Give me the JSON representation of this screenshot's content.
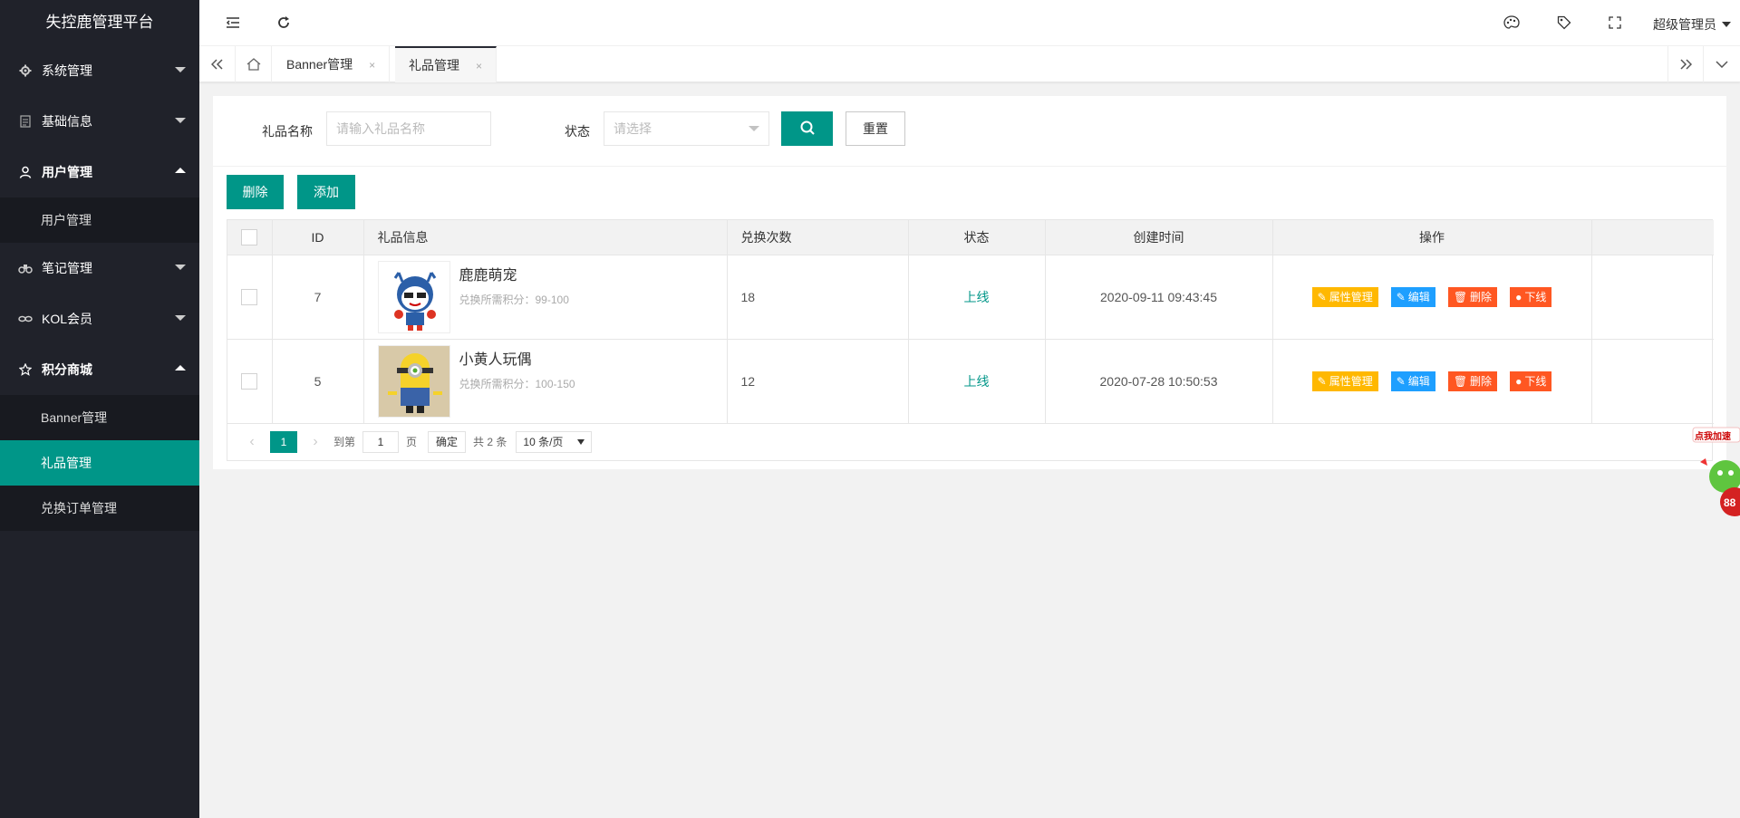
{
  "app": {
    "title": "失控鹿管理平台"
  },
  "sidebar": {
    "items": [
      {
        "label": "系统管理",
        "icon": "gear-icon",
        "open": false
      },
      {
        "label": "基础信息",
        "icon": "document-icon",
        "open": false
      },
      {
        "label": "用户管理",
        "icon": "user-icon",
        "open": true,
        "children": [
          "用户管理"
        ]
      },
      {
        "label": "笔记管理",
        "icon": "binoculars-icon",
        "open": false
      },
      {
        "label": "KOL会员",
        "icon": "link-icon",
        "open": false
      },
      {
        "label": "积分商城",
        "icon": "star-icon",
        "open": true,
        "children": [
          "Banner管理",
          "礼品管理",
          "兑换订单管理"
        ]
      }
    ]
  },
  "header": {
    "admin": "超级管理员"
  },
  "tabs": [
    {
      "label": "Banner管理",
      "close": "×"
    },
    {
      "label": "礼品管理",
      "close": "×"
    }
  ],
  "search": {
    "name_label": "礼品名称",
    "name_placeholder": "请输入礼品名称",
    "status_label": "状态",
    "status_placeholder": "请选择",
    "reset_label": "重置"
  },
  "toolbar": {
    "delete_label": "删除",
    "add_label": "添加"
  },
  "table": {
    "headers": [
      "ID",
      "礼品信息",
      "兑换次数",
      "状态",
      "创建时间",
      "操作"
    ],
    "rows": [
      {
        "id": "7",
        "name": "鹿鹿萌宠",
        "points": "兑换所需积分：99-100",
        "count": "18",
        "status": "上线",
        "created": "2020-09-11 09:43:45"
      },
      {
        "id": "5",
        "name": "小黄人玩偶",
        "points": "兑换所需积分：100-150",
        "count": "12",
        "status": "上线",
        "created": "2020-07-28 10:50:53"
      }
    ],
    "ops": {
      "attr": "属性管理",
      "edit": "编辑",
      "delete": "删除",
      "offline": "下线"
    }
  },
  "pager": {
    "current": "1",
    "goto_label": "到第",
    "page_value": "1",
    "page_unit": "页",
    "confirm": "确定",
    "total": "共 2 条",
    "page_size": "10 条/页"
  },
  "float_widget": {
    "label": "点我加速",
    "badge": "88"
  },
  "colors": {
    "sidebar": "#20222a",
    "accent": "#009688",
    "attr": "#FFB800",
    "edit": "#1E9FFF",
    "danger": "#FF5722"
  }
}
